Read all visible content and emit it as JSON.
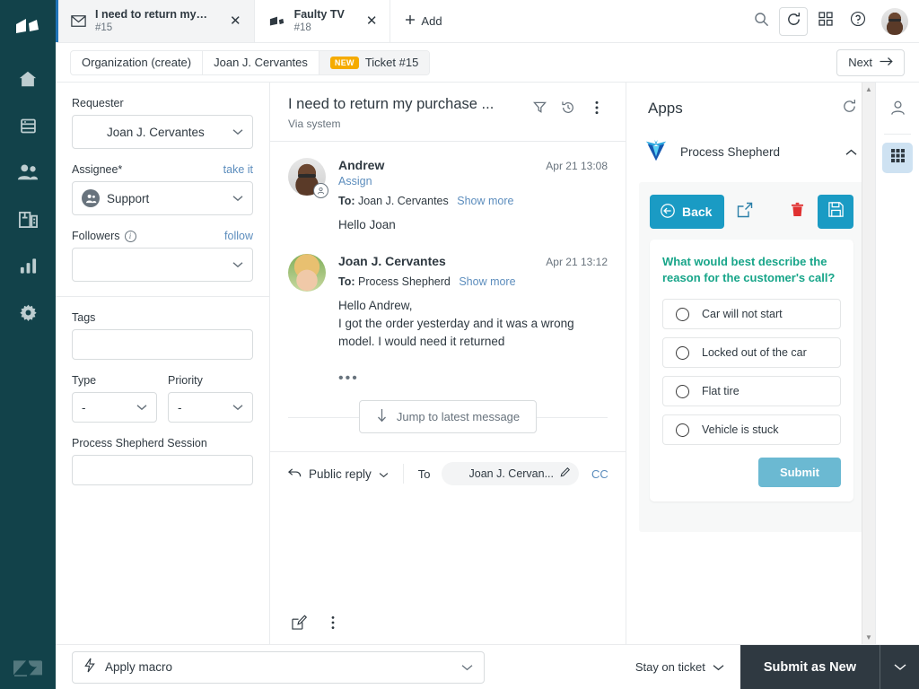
{
  "nav": {
    "logo": "zendesk-logo-mark",
    "items": [
      {
        "name": "home",
        "icon": "home-icon"
      },
      {
        "name": "views",
        "icon": "views-icon"
      },
      {
        "name": "customers",
        "icon": "customers-icon"
      },
      {
        "name": "organizations",
        "icon": "organizations-icon"
      },
      {
        "name": "reporting",
        "icon": "reporting-icon"
      },
      {
        "name": "admin",
        "icon": "gear-icon"
      }
    ],
    "footer_logo": "zendesk-logo"
  },
  "tabs": [
    {
      "title": "I need to return my purc...",
      "number": "#15",
      "icon": "mail-icon",
      "active": true
    },
    {
      "title": "Faulty TV",
      "number": "#18",
      "icon": "ticket-icon",
      "active": false
    }
  ],
  "tabbar": {
    "add_label": "Add",
    "search_icon": "search-icon",
    "refresh_icon": "refresh-icon",
    "apps_icon": "apps-grid-icon",
    "help_icon": "help-icon",
    "avatar": "user-avatar"
  },
  "breadcrumb": {
    "items": [
      {
        "label": "Organization (create)",
        "badge": null
      },
      {
        "label": "Joan J. Cervantes",
        "badge": null
      },
      {
        "label": "Ticket #15",
        "badge": "NEW"
      }
    ],
    "next_label": "Next"
  },
  "properties": {
    "requester": {
      "label": "Requester",
      "value": "Joan J. Cervantes"
    },
    "assignee": {
      "label": "Assignee*",
      "action": "take it",
      "value": "Support"
    },
    "followers": {
      "label": "Followers",
      "action": "follow",
      "value": ""
    },
    "tags": {
      "label": "Tags",
      "value": ""
    },
    "type": {
      "label": "Type",
      "value": "-"
    },
    "priority": {
      "label": "Priority",
      "value": "-"
    },
    "session": {
      "label": "Process Shepherd Session",
      "value": ""
    }
  },
  "conversation": {
    "title": "I need to return my purchase ...",
    "subtitle": "Via system",
    "actions": [
      "filter-icon",
      "history-icon",
      "more-icon"
    ],
    "messages": [
      {
        "author": "Andrew",
        "time": "Apr 21 13:08",
        "assign_link": "Assign",
        "to_label": "To:",
        "to_value": "Joan J. Cervantes",
        "show_more": "Show more",
        "text": "Hello Joan",
        "avatar": "andrew-avatar"
      },
      {
        "author": "Joan J. Cervantes",
        "time": "Apr 21 13:12",
        "assign_link": "",
        "to_label": "To:",
        "to_value": "Process Shepherd",
        "show_more": "Show more",
        "text": "Hello Andrew,\nI got the order yesterday and it was a wrong\nmodel. I would need it returned",
        "avatar": "joan-avatar"
      }
    ],
    "jump_label": "Jump to latest message"
  },
  "composer": {
    "reply_type": "Public reply",
    "to_label": "To",
    "recipient": "Joan J. Cervan...",
    "cc_label": "CC",
    "edit_icon": "pencil-icon",
    "foot_icons": [
      "compose-icon",
      "more-vertical-icon"
    ]
  },
  "apps": {
    "title": "Apps",
    "refresh_icon": "refresh-icon",
    "app": {
      "name": "Process Shepherd",
      "logo": "process-shepherd-logo",
      "collapse_icon": "chevron-up-icon",
      "toolbar": {
        "back_label": "Back",
        "open_icon": "open-external-icon",
        "delete_icon": "trash-icon",
        "save_icon": "save-icon"
      },
      "question": "What would best describe the reason for the customer's call?",
      "options": [
        "Car will not start",
        "Locked out of the car",
        "Flat tire",
        "Vehicle is stuck"
      ],
      "selected_option": null,
      "submit_label": "Submit"
    }
  },
  "right_rail": {
    "items": [
      {
        "name": "user-icon",
        "active": false
      },
      {
        "name": "apps-grid-icon",
        "active": true
      }
    ]
  },
  "footer": {
    "macro_label": "Apply macro",
    "macro_icon": "bolt-icon",
    "stay_label": "Stay on ticket",
    "submit_label": "Submit as New"
  },
  "colors": {
    "nav_background": "#12424a",
    "accent_blue": "#1f73b7",
    "link_blue": "#5c8dbd",
    "badge_orange": "#f5ab00",
    "app_teal": "#1a9bc4",
    "question_green": "#17a589",
    "submit_light": "#6bb9d2",
    "submit_dark": "#2f3941"
  }
}
